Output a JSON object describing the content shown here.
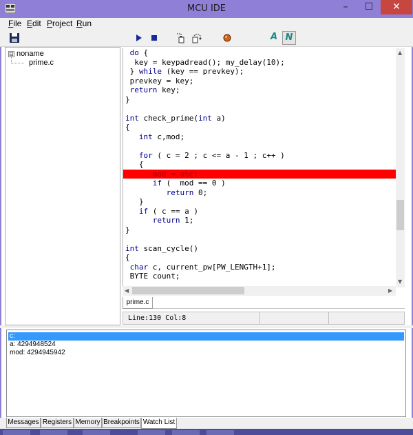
{
  "window": {
    "title": "MCU IDE",
    "minimize": "–",
    "maximize": "☐",
    "close": "✕"
  },
  "menu": [
    {
      "label": "File"
    },
    {
      "label": "Edit"
    },
    {
      "label": "Project"
    },
    {
      "label": "Run"
    }
  ],
  "toolbar": {
    "ansi_label": "A",
    "normal_label": "N"
  },
  "tree": {
    "root": "noname",
    "toggle": "⊟",
    "child": "prime.c"
  },
  "code_lines": [
    " do {",
    "  key = keypadread(); my_delay(10);",
    " } while (key == prevkey);",
    " prevkey = key;",
    " return key;",
    "}",
    "",
    "int check_prime(int a)",
    "{",
    "   int c,mod;",
    "",
    "   for ( c = 2 ; c <= a - 1 ; c++ )",
    "   {",
    "      mod = a%c;",
    "      if (  mod == 0 )",
    "         return 0;",
    "   }",
    "   if ( c == a )",
    "      return 1;",
    "}",
    "",
    "int scan_cycle()",
    "{",
    " char c, current_pw[PW_LENGTH+1];",
    " BYTE count;"
  ],
  "highlight_line_index": 13,
  "editor_tab": "prime.c",
  "status": {
    "position": "Line:130 Col:8",
    "cell2": "",
    "cell3": ""
  },
  "watch": [
    {
      "text": "c:",
      "selected": true
    },
    {
      "text": "a: 4294948524",
      "selected": false
    },
    {
      "text": "mod: 4294945942",
      "selected": false
    }
  ],
  "bottom_tabs": [
    {
      "label": "Messages",
      "active": false
    },
    {
      "label": "Registers",
      "active": false
    },
    {
      "label": "Memory",
      "active": false
    },
    {
      "label": "Breakpoints",
      "active": false
    },
    {
      "label": "Watch List",
      "active": true
    }
  ],
  "colors": {
    "titlebar": "#8f7fd6",
    "highlight": "#ff0000",
    "selection": "#3399ff",
    "keyword": "#00008b"
  }
}
